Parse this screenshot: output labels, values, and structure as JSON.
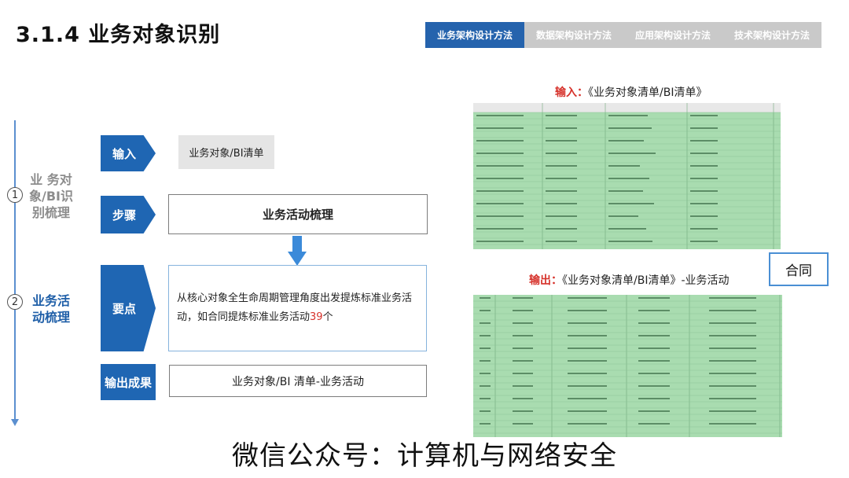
{
  "page_title": "3.1.4 业务对象识别",
  "tabs": [
    {
      "label": "业务架构设计方法",
      "active": true
    },
    {
      "label": "数据架构设计方法",
      "active": false
    },
    {
      "label": "应用架构设计方法",
      "active": false
    },
    {
      "label": "技术架构设计方法",
      "active": false
    }
  ],
  "steps": [
    {
      "num": "1",
      "label": "业 务对\n象/BI识\n别梳理"
    },
    {
      "num": "2",
      "label": "业务活\n动梳理"
    }
  ],
  "flow": {
    "input_label": "输入",
    "input_value": "业务对象/BI清单",
    "step_label": "步骤",
    "step_value": "业务活动梳理",
    "key_label": "要点",
    "key_text_before": "从核心对象全生命周期管理角度出发提炼标准业务活动，如合同提炼标准业务活动",
    "key_count": "39",
    "key_text_after": "个",
    "output_label": "输出成果",
    "output_value": "业务对象/BI 清单-业务活动"
  },
  "right": {
    "input_caption_prefix": "输入：",
    "input_caption_text": "《业务对象清单/BI清单》",
    "output_caption_prefix": "输出：",
    "output_caption_text": "《业务对象清单/BI清单》-业务活动",
    "contract_label": "合同",
    "sheet_color": "#a9dcb0"
  },
  "footer": "微信公众号：计算机与网络安全"
}
